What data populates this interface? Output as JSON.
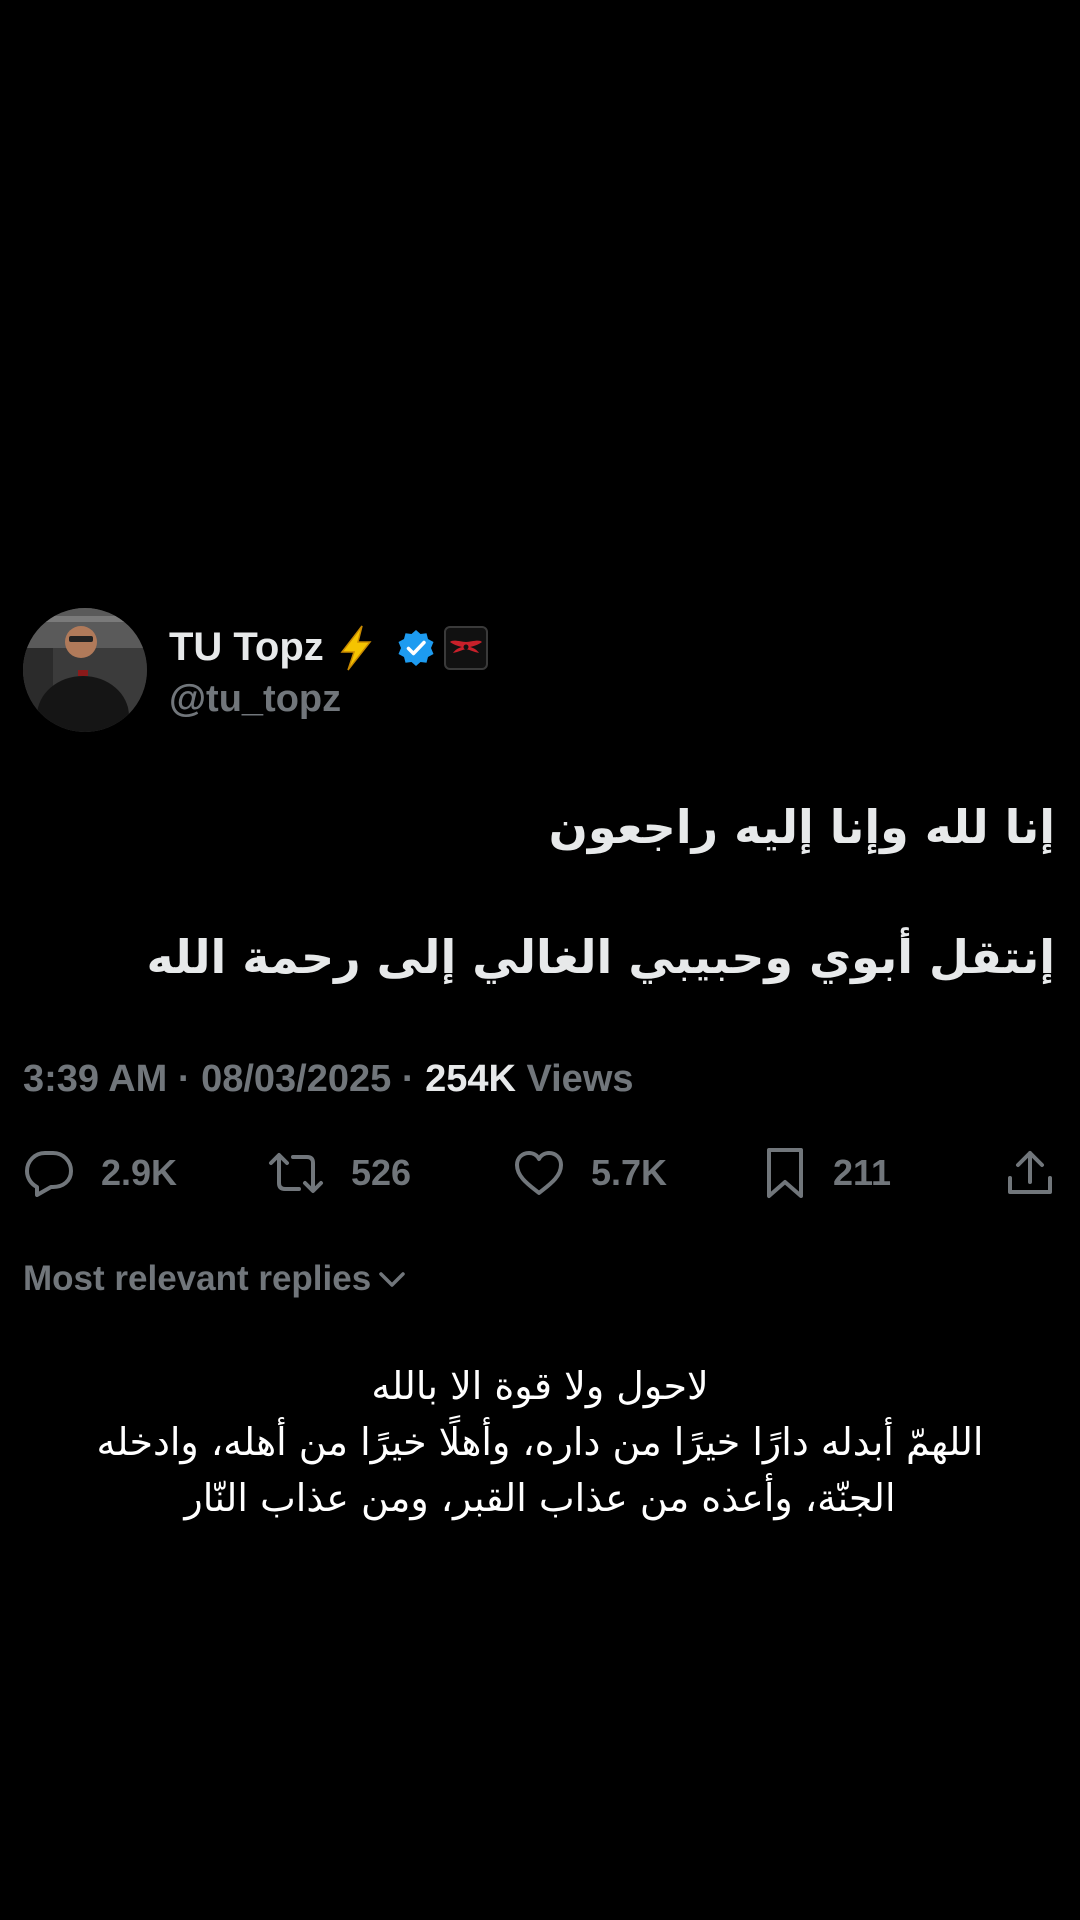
{
  "tweet": {
    "author": {
      "display_name": "TU Topz",
      "handle": "@tu_topz",
      "emoji": "⚡",
      "verified": true
    },
    "text_lines": [
      "إنا لله وإنا إليه راجعون",
      "إنتقل أبوي وحبيبي الغالي إلى رحمة الله"
    ],
    "time": "3:39 AM",
    "date": "08/03/2025",
    "separator": "·",
    "views_count": "254K",
    "views_label": "Views",
    "stats": {
      "replies": "2.9K",
      "reposts": "526",
      "likes": "5.7K",
      "bookmarks": "211"
    }
  },
  "replies_section": {
    "filter_label": "Most relevant replies"
  },
  "reply": {
    "lines": [
      "لاحول ولا قوة الا بالله",
      "اللهمّ أبدله دارًا خيرًا من داره، وأهلًا خيرًا من أهله، وادخله",
      "الجنّة، وأعذه من عذاب القبر، ومن عذاب النّار"
    ]
  },
  "colors": {
    "background": "#000000",
    "primary_text": "#e7e9ea",
    "secondary_text": "#71767b",
    "verified_blue": "#1d9bf0",
    "bolt_yellow": "#f5c400"
  }
}
